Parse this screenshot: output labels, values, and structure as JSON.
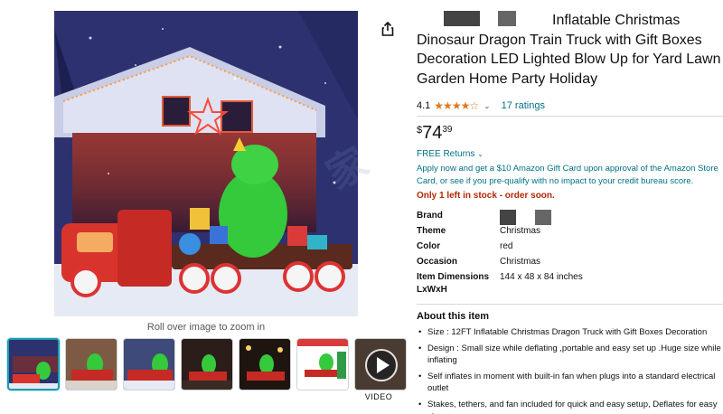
{
  "gallery": {
    "zoom_hint": "Roll over image to zoom in",
    "video_label": "VIDEO",
    "thumbnails": [
      "thumb-1",
      "thumb-2",
      "thumb-3",
      "thumb-4",
      "thumb-5",
      "thumb-6",
      "video"
    ]
  },
  "icons": {
    "share": "share-icon",
    "play": "play-icon",
    "chevron": "chevron-down-icon"
  },
  "product": {
    "title_line1": "Inflatable Christmas",
    "title_rest": "Dinosaur Dragon Train Truck with Gift Boxes Decoration LED Lighted Blow Up for Yard Lawn Garden Home Party Holiday",
    "rating_value": "4.1",
    "stars": "★★★★☆",
    "ratings_count": "17 ratings",
    "price_symbol": "$",
    "price_whole": "74",
    "price_fraction": "39",
    "returns": "FREE Returns",
    "gift_card_offer": "Apply now and get a $10 Amazon Gift Card upon approval of the Amazon Store Card, or see if you pre-qualify with no impact to your credit bureau score.",
    "stock": "Only 1 left in stock - order soon."
  },
  "specs": [
    {
      "key": "Brand",
      "value": ""
    },
    {
      "key": "Theme",
      "value": "Christmas"
    },
    {
      "key": "Color",
      "value": "red"
    },
    {
      "key": "Occasion",
      "value": "Christmas"
    },
    {
      "key": "Item Dimensions LxWxH",
      "value": "144 x 48 x 84 inches"
    }
  ],
  "about": {
    "heading": "About this item",
    "bullets": [
      "Size : 12FT Inflatable Christmas Dragon Truck with Gift Boxes Decoration",
      "Design : Small size while deflating ,portable and easy set up .Huge size while inflating",
      "Self inflates in moment with built-in fan when plugs into a standard electrical outlet",
      "Stakes, tethers, and fan included for quick and easy setup, Deflates for easy storage"
    ]
  },
  "colors": {
    "link": "#007185",
    "star": "#de7921",
    "stock": "#B12704",
    "thumb_selected": "#1f9bb2"
  }
}
